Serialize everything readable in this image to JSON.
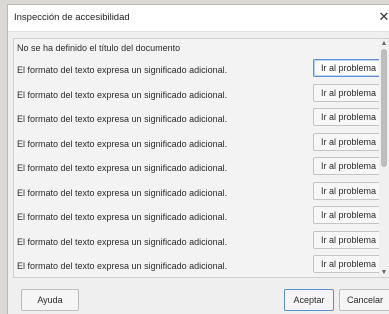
{
  "window": {
    "title": "Inspección de accesibilidad"
  },
  "icons": {
    "close": "close-icon",
    "scroll_up": "chevron-up-icon",
    "scroll_down": "chevron-down-icon"
  },
  "list": {
    "first_item": "No se ha definido el título del documento",
    "issues": [
      {
        "text": "El formato del texto expresa un significado adicional.",
        "button": "Ir al problema"
      },
      {
        "text": "El formato del texto expresa un significado adicional.",
        "button": "Ir al problema"
      },
      {
        "text": "El formato del texto expresa un significado adicional.",
        "button": "Ir al problema"
      },
      {
        "text": "El formato del texto expresa un significado adicional.",
        "button": "Ir al problema"
      },
      {
        "text": "El formato del texto expresa un significado adicional.",
        "button": "Ir al problema"
      },
      {
        "text": "El formato del texto expresa un significado adicional.",
        "button": "Ir al problema"
      },
      {
        "text": "El formato del texto expresa un significado adicional.",
        "button": "Ir al problema"
      },
      {
        "text": "El formato del texto expresa un significado adicional.",
        "button": "Ir al problema"
      },
      {
        "text": "El formato del texto expresa un significado adicional.",
        "button": "Ir al problema"
      }
    ]
  },
  "footer": {
    "help": "Ayuda",
    "accept": "Aceptar",
    "cancel": "Cancelar"
  },
  "colors": {
    "focus": "#5d8fd3",
    "dialog_bg": "#efefef"
  }
}
